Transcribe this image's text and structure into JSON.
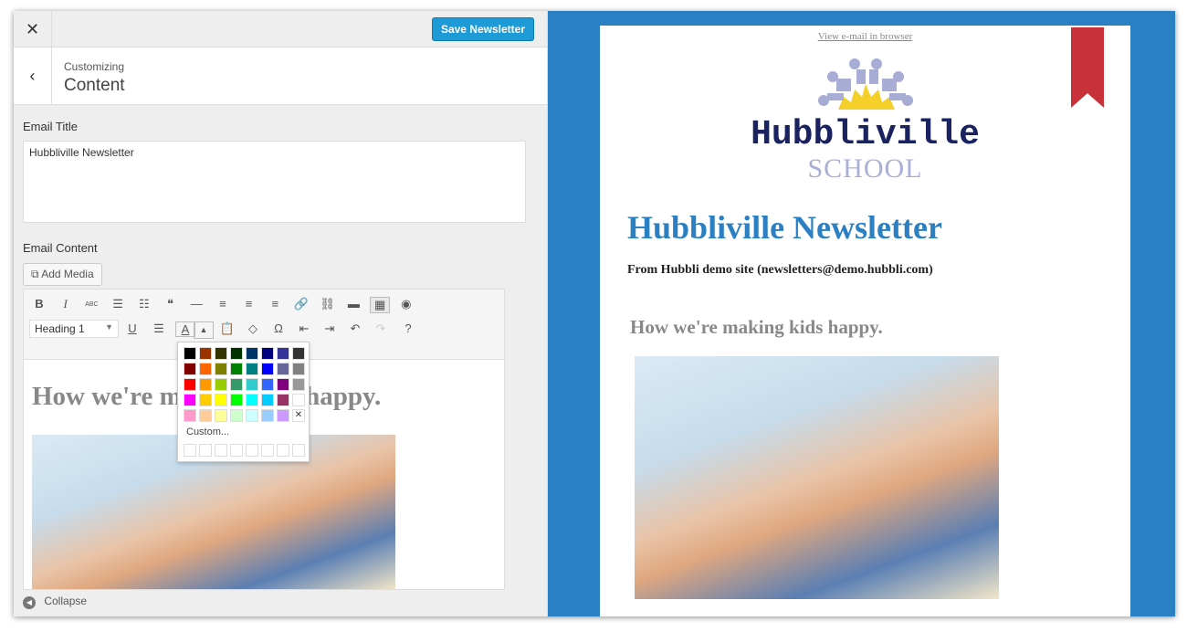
{
  "header": {
    "close_icon": "close-icon",
    "save_label": "Save Newsletter"
  },
  "breadcrumb": {
    "parent": "Customizing",
    "current": "Content"
  },
  "email_title": {
    "label": "Email Title",
    "value": "Hubbliville Newsletter"
  },
  "email_content": {
    "label": "Email Content",
    "add_media": "Add Media",
    "toolbar_row1": [
      {
        "name": "bold",
        "glyph": "B"
      },
      {
        "name": "italic",
        "glyph": "I"
      },
      {
        "name": "strikethrough",
        "glyph": "ABC"
      },
      {
        "name": "bullet-list",
        "glyph": "☰"
      },
      {
        "name": "numbered-list",
        "glyph": "☷"
      },
      {
        "name": "blockquote",
        "glyph": "❝"
      },
      {
        "name": "horizontal-line",
        "glyph": "—"
      },
      {
        "name": "align-left",
        "glyph": "≡"
      },
      {
        "name": "align-center",
        "glyph": "≡"
      },
      {
        "name": "align-right",
        "glyph": "≡"
      },
      {
        "name": "link",
        "glyph": "🔗"
      },
      {
        "name": "unlink",
        "glyph": "⛓"
      },
      {
        "name": "read-more",
        "glyph": "▬"
      },
      {
        "name": "toolbar-toggle",
        "glyph": "▦"
      },
      {
        "name": "contact-form",
        "glyph": "◉"
      }
    ],
    "format_select": "Heading 1",
    "toolbar_row2": [
      {
        "name": "underline",
        "glyph": "U"
      },
      {
        "name": "justify",
        "glyph": "☰"
      },
      {
        "name": "text-color",
        "glyph": "A"
      },
      {
        "name": "text-color-dropdown",
        "glyph": "▲"
      },
      {
        "name": "paste-text",
        "glyph": "📋"
      },
      {
        "name": "clear-formatting",
        "glyph": "◇"
      },
      {
        "name": "special-character",
        "glyph": "Ω"
      },
      {
        "name": "outdent",
        "glyph": "⇤"
      },
      {
        "name": "indent",
        "glyph": "⇥"
      },
      {
        "name": "undo",
        "glyph": "↶"
      },
      {
        "name": "redo",
        "glyph": "↷"
      },
      {
        "name": "help",
        "glyph": "?"
      }
    ],
    "heading": "How we're making kids happy."
  },
  "color_picker": {
    "colors": [
      "#000000",
      "#993300",
      "#333300",
      "#003300",
      "#003366",
      "#000080",
      "#333399",
      "#333333",
      "#800000",
      "#FF6600",
      "#808000",
      "#008000",
      "#008080",
      "#0000FF",
      "#666699",
      "#808080",
      "#FF0000",
      "#FF9900",
      "#99CC00",
      "#339966",
      "#33CCCC",
      "#3366FF",
      "#800080",
      "#999999",
      "#FF00FF",
      "#FFCC00",
      "#FFFF00",
      "#00FF00",
      "#00FFFF",
      "#00CCFF",
      "#993366",
      "#FFFFFF",
      "#FF99CC",
      "#FFCC99",
      "#FFFF99",
      "#CCFFCC",
      "#CCFFFF",
      "#99CCFF",
      "#CC99FF"
    ],
    "no_color": "✕",
    "custom_label": "Custom..."
  },
  "footer": {
    "collapse": "Collapse"
  },
  "preview": {
    "view_link": "View e-mail in browser",
    "logo_name": "Hubbliville",
    "logo_school": "SCHOOL",
    "title": "Hubbliville Newsletter",
    "from": "From Hubbli demo site (newsletters@demo.hubbli.com)",
    "heading": "How we're making kids happy.",
    "accent": "#2b7fc3"
  }
}
